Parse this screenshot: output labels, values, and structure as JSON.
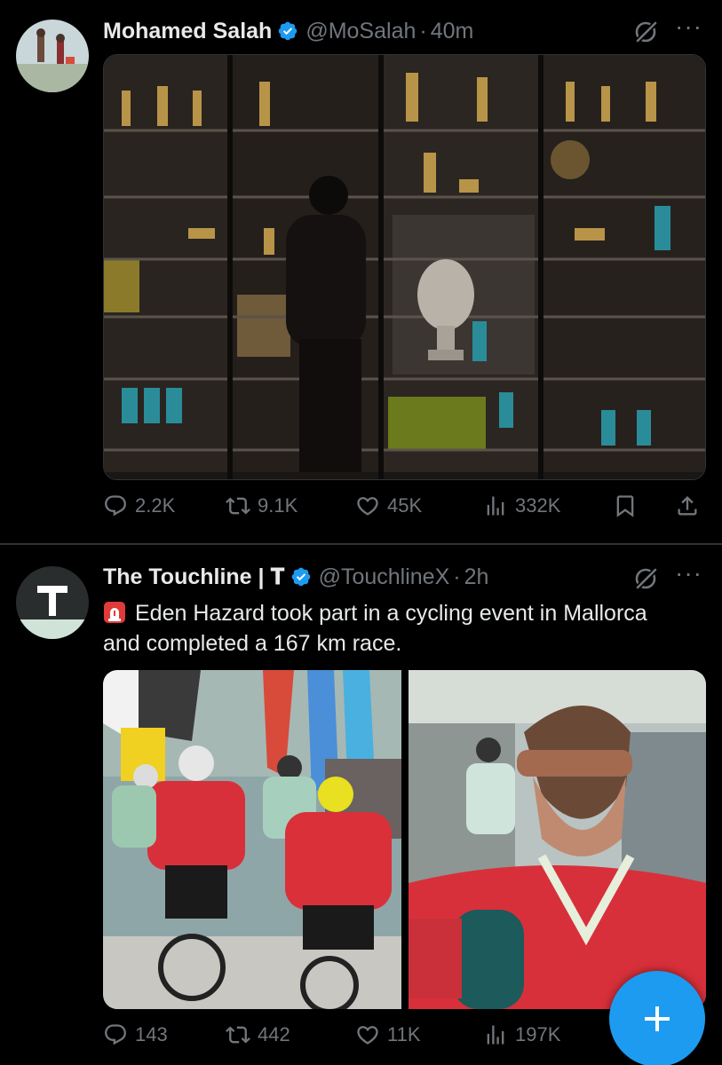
{
  "tweets": [
    {
      "author": "Mohamed Salah",
      "handle": "@MoSalah",
      "separator": "·",
      "time": "40m",
      "text": "",
      "media": [
        "trophy-cabinet-photo"
      ],
      "stats": {
        "replies": "2.2K",
        "retweets": "9.1K",
        "likes": "45K",
        "views": "332K"
      }
    },
    {
      "author": "The Touchline | 𝐓",
      "handle": "@TouchlineX",
      "separator": "·",
      "time": "2h",
      "text_emoji": "siren-icon",
      "text": "Eden Hazard took part in a cycling event in Mallorca and completed a 167 km race.",
      "media": [
        "cycling-race-photo",
        "interview-photo"
      ],
      "stats": {
        "replies": "143",
        "retweets": "442",
        "likes": "11K",
        "views": "197K"
      }
    }
  ],
  "colors": {
    "background": "#000000",
    "text": "#e7e9ea",
    "muted": "#71767b",
    "accent": "#1d9bf0",
    "divider": "#2f3336"
  },
  "fab": {
    "icon": "plus-icon"
  }
}
